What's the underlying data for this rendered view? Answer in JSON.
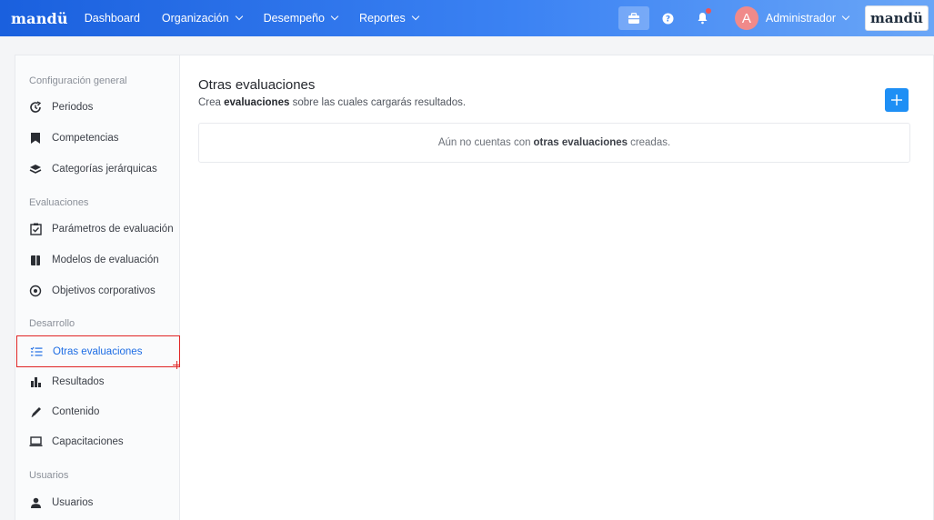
{
  "topbar": {
    "brand": "mandü",
    "nav": [
      {
        "label": "Dashboard",
        "dropdown": false
      },
      {
        "label": "Organización",
        "dropdown": true
      },
      {
        "label": "Desempeño",
        "dropdown": true
      },
      {
        "label": "Reportes",
        "dropdown": true
      }
    ],
    "notification_count": "1",
    "avatar_initial": "A",
    "user_name": "Administrador",
    "logo_text": "mandü"
  },
  "sidebar": {
    "sections": [
      {
        "title": "Configuración general"
      },
      {
        "title": "Evaluaciones"
      },
      {
        "title": "Desarrollo"
      },
      {
        "title": "Usuarios"
      }
    ],
    "items": [
      {
        "label": "Periodos",
        "icon": "clock-refresh-icon"
      },
      {
        "label": "Competencias",
        "icon": "bookmark-icon"
      },
      {
        "label": "Categorías jerárquicas",
        "icon": "layers-icon"
      },
      {
        "label": "Parámetros de evaluación",
        "icon": "checkbox-icon"
      },
      {
        "label": "Modelos de evaluación",
        "icon": "book-icon"
      },
      {
        "label": "Objetivos corporativos",
        "icon": "target-icon"
      },
      {
        "label": "Otras evaluaciones",
        "icon": "list-icon",
        "selected": true
      },
      {
        "label": "Resultados",
        "icon": "bar-chart-icon"
      },
      {
        "label": "Contenido",
        "icon": "pencil-icon"
      },
      {
        "label": "Capacitaciones",
        "icon": "laptop-icon"
      },
      {
        "label": "Usuarios",
        "icon": "user-icon"
      }
    ]
  },
  "main": {
    "title": "Otras evaluaciones",
    "subtitle_pre": "Crea",
    "subtitle_bold": "evaluaciones",
    "subtitle_post": "sobre las cuales cargarás resultados.",
    "empty_pre": "Aún no cuentas con",
    "empty_bold": "otras evaluaciones",
    "empty_post": "creadas."
  },
  "colors": {
    "accent": "#1e8ff5",
    "selected_text": "#1e6de4",
    "highlight_border": "#e02424"
  }
}
